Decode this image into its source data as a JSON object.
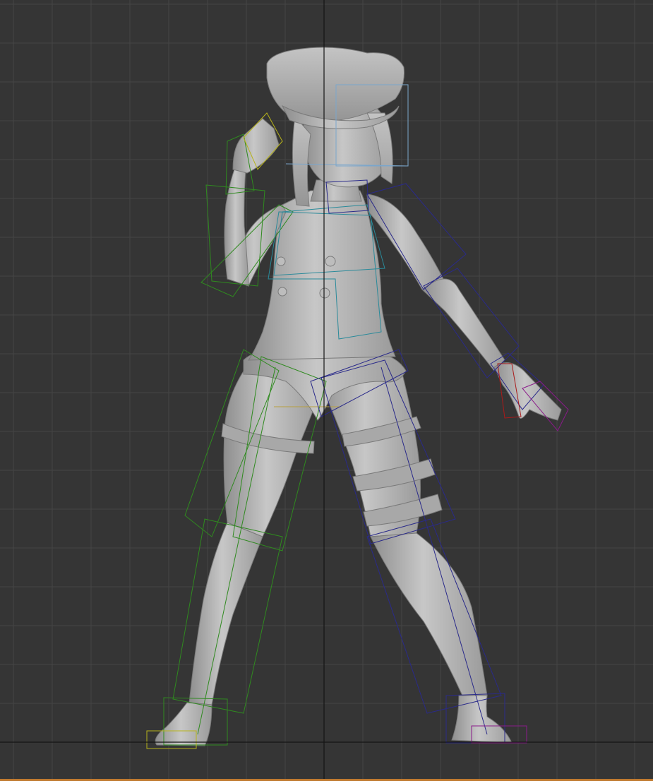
{
  "viewport": {
    "background": "#353535",
    "grid": true,
    "grid_color": "#454545",
    "axis_color": "#141414",
    "frame_color": "#c07a2f"
  },
  "scene": {
    "model_color": "#b8b8b8",
    "model_shadow": "#8c8c8c",
    "bones_left": "#2f8a1f",
    "bones_right": "#2a2a8a",
    "bones_spine": "#2a8a9a",
    "bones_head": "#7aa6cc",
    "bones_left_hand": "#b8b41a",
    "bones_right_hand_a": "#aa1a1a",
    "bones_right_hand_b": "#8a1a8a"
  }
}
